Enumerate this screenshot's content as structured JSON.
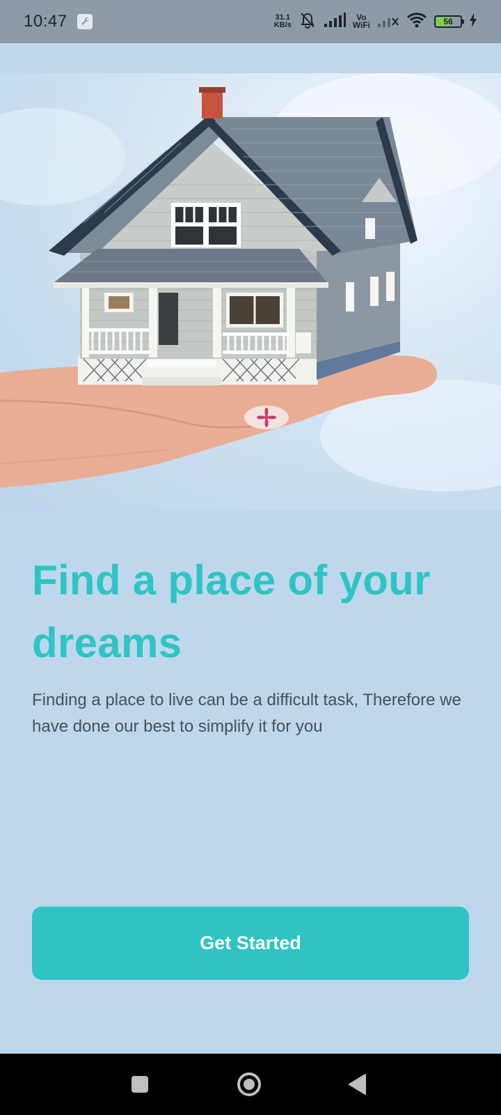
{
  "status_bar": {
    "time": "10:47",
    "net_speed_value": "31.1",
    "net_speed_unit": "KB/s",
    "vo_top": "Vo",
    "vo_bottom": "WiFi",
    "battery_level": "56",
    "icons": [
      "wrench-icon",
      "bell-off-icon",
      "signal-icon",
      "vowifi-icon",
      "signal-off-icon",
      "wifi-icon",
      "battery-icon",
      "charging-icon"
    ]
  },
  "hero": {
    "image": "house-on-hand-photo"
  },
  "onboarding": {
    "title": "Find a place of your dreams",
    "description": "Finding a place to live can be a difficult task, Therefore we have done our best to simplify it for you",
    "cta_label": "Get Started"
  },
  "colors": {
    "background": "#bed7eb",
    "accent": "#2ec4c4",
    "status_bar": "#8e9ba7",
    "body_text": "#46505a"
  },
  "nav_bar": {
    "icons": [
      "recents-icon",
      "home-icon",
      "back-icon"
    ]
  }
}
